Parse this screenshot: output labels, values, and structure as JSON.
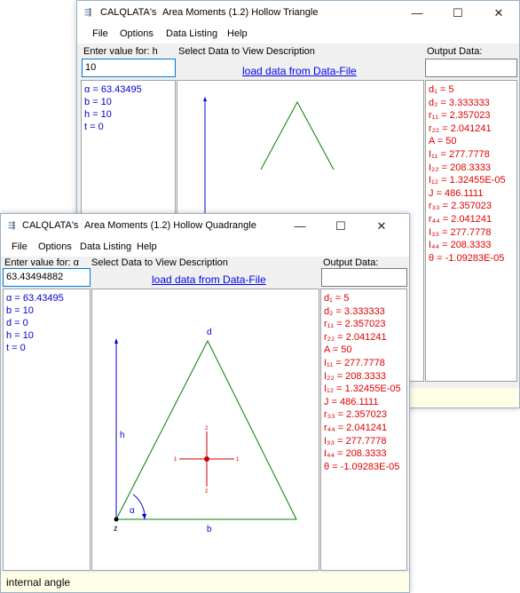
{
  "back_window": {
    "app": "CALQLATA's",
    "title": "Area Moments (1.2)  Hollow Triangle",
    "menu": [
      "File",
      "Options",
      "Data Listing",
      "Help"
    ],
    "enter_label": "Enter value for: h",
    "input_value": "10",
    "select_label": "Select Data to View Description",
    "load_link": "load data from Data-File",
    "output_label": "Output Data:",
    "params": [
      "α = 63.43495",
      "b = 10",
      "h = 10",
      "t = 0"
    ],
    "outputs": [
      "d₁ = 5",
      "d₂ = 3.333333",
      "r₁₁ = 2.357023",
      "r₂₂ = 2.041241",
      "A = 50",
      "I₁₁ = 277.7778",
      "I₂₂ = 208.3333",
      "I₁₂ = 1.32455E-05",
      "J = 486.1111",
      "r₃₃ = 2.357023",
      "r₄₄ = 2.041241",
      "I₃₃ = 277.7778",
      "I₄₄ = 208.3333",
      "θ = -1.09283E-05"
    ]
  },
  "front_window": {
    "app": "CALQLATA's",
    "title": "Area Moments (1.2)  Hollow Quadrangle",
    "menu": [
      "File",
      "Options",
      "Data Listing",
      "Help"
    ],
    "enter_label": "Enter value for: α",
    "input_value": "63.43494882",
    "select_label": "Select Data to View Description",
    "load_link": "load data from Data-File",
    "output_label": "Output Data:",
    "params": [
      "α = 63.43495",
      "b = 10",
      "d = 0",
      "h = 10",
      "t = 0"
    ],
    "outputs": [
      "d₁ = 5",
      "d₂ = 3.333333",
      "r₁₁ = 2.357023",
      "r₂₂ = 2.041241",
      "A = 50",
      "I₁₁ = 277.7778",
      "I₂₂ = 208.3333",
      "I₁₂ = 1.32455E-05",
      "J = 486.1111",
      "r₃₃ = 2.357023",
      "r₄₄ = 2.041241",
      "I₃₃ = 277.7778",
      "I₄₄ = 208.3333",
      "θ = -1.09283E-05"
    ],
    "status": "internal angle",
    "diagram": {
      "d": "d",
      "h": "h",
      "b": "b",
      "alpha": "α",
      "z": "z",
      "axis_2": "2",
      "axis_1": "1"
    }
  },
  "controls": {
    "minimize": "—",
    "maximize": "☐",
    "close": "✕"
  },
  "icons": {
    "app": "app-icon"
  },
  "colors": {
    "triangle": "#008000",
    "dimension": "#0000cc",
    "centroid": "#cc0000",
    "params_text": "#0000cc",
    "outputs_text": "#e00000"
  }
}
